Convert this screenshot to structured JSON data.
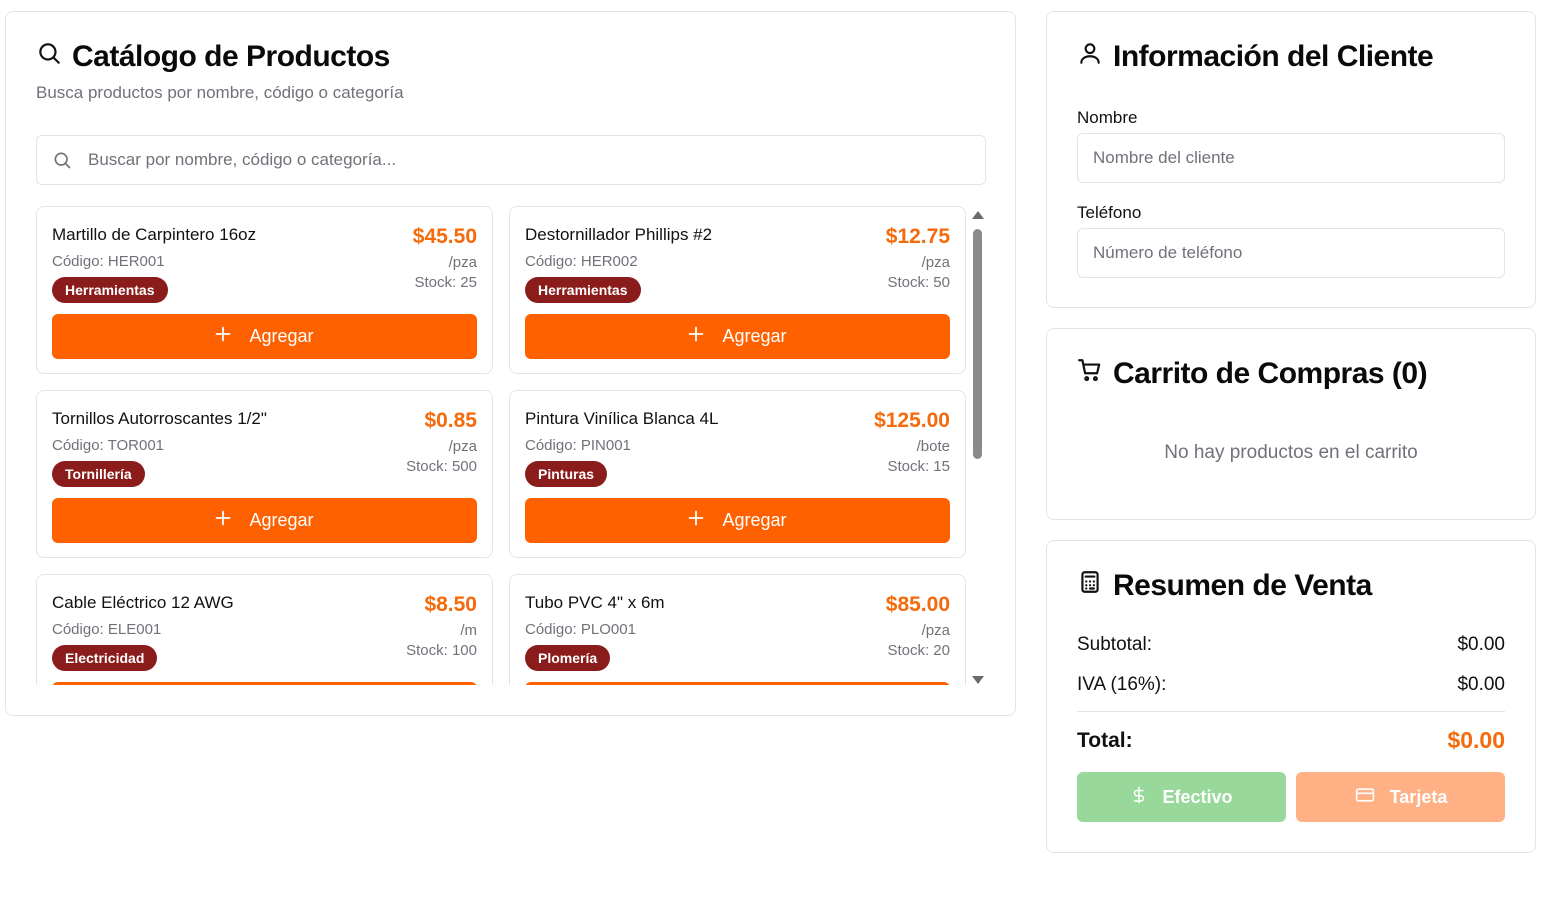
{
  "catalog": {
    "title": "Catálogo de Productos",
    "subtitle": "Busca productos por nombre, código o categoría",
    "search_placeholder": "Buscar por nombre, código o categoría...",
    "add_label": "Agregar",
    "products": [
      {
        "name": "Martillo de Carpintero 16oz",
        "code": "Código: HER001",
        "category": "Herramientas",
        "price": "$45.50",
        "unit": "/pza",
        "stock": "Stock: 25"
      },
      {
        "name": "Destornillador Phillips #2",
        "code": "Código: HER002",
        "category": "Herramientas",
        "price": "$12.75",
        "unit": "/pza",
        "stock": "Stock: 50"
      },
      {
        "name": "Tornillos Autorroscantes 1/2\"",
        "code": "Código: TOR001",
        "category": "Tornillería",
        "price": "$0.85",
        "unit": "/pza",
        "stock": "Stock: 500"
      },
      {
        "name": "Pintura Vinílica Blanca 4L",
        "code": "Código: PIN001",
        "category": "Pinturas",
        "price": "$125.00",
        "unit": "/bote",
        "stock": "Stock: 15"
      },
      {
        "name": "Cable Eléctrico 12 AWG",
        "code": "Código: ELE001",
        "category": "Electricidad",
        "price": "$8.50",
        "unit": "/m",
        "stock": "Stock: 100"
      },
      {
        "name": "Tubo PVC 4\" x 6m",
        "code": "Código: PLO001",
        "category": "Plomería",
        "price": "$85.00",
        "unit": "/pza",
        "stock": "Stock: 20"
      }
    ]
  },
  "client": {
    "title": "Información del Cliente",
    "name_label": "Nombre",
    "name_placeholder": "Nombre del cliente",
    "phone_label": "Teléfono",
    "phone_placeholder": "Número de teléfono"
  },
  "cart": {
    "title": "Carrito de Compras (0)",
    "empty_message": "No hay productos en el carrito"
  },
  "summary": {
    "title": "Resumen de Venta",
    "subtotal_label": "Subtotal:",
    "subtotal_value": "$0.00",
    "iva_label": "IVA (16%):",
    "iva_value": "$0.00",
    "total_label": "Total:",
    "total_value": "$0.00",
    "cash_label": "Efectivo",
    "card_label": "Tarjeta"
  },
  "colors": {
    "accent": "#ff6000",
    "price": "#f56a0a",
    "badge": "#8b1c1c",
    "cash_button": "#98d89b",
    "card_button": "#ffb084"
  }
}
